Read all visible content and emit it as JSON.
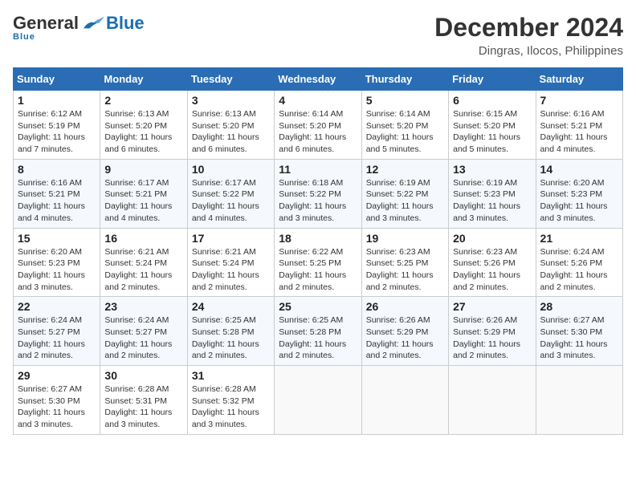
{
  "logo": {
    "general": "General",
    "blue": "Blue",
    "underline": "Blue"
  },
  "title": {
    "month": "December 2024",
    "location": "Dingras, Ilocos, Philippines"
  },
  "weekdays": [
    "Sunday",
    "Monday",
    "Tuesday",
    "Wednesday",
    "Thursday",
    "Friday",
    "Saturday"
  ],
  "weeks": [
    [
      {
        "day": "1",
        "sunrise": "6:12 AM",
        "sunset": "5:19 PM",
        "daylight": "11 hours and 7 minutes."
      },
      {
        "day": "2",
        "sunrise": "6:13 AM",
        "sunset": "5:20 PM",
        "daylight": "11 hours and 6 minutes."
      },
      {
        "day": "3",
        "sunrise": "6:13 AM",
        "sunset": "5:20 PM",
        "daylight": "11 hours and 6 minutes."
      },
      {
        "day": "4",
        "sunrise": "6:14 AM",
        "sunset": "5:20 PM",
        "daylight": "11 hours and 6 minutes."
      },
      {
        "day": "5",
        "sunrise": "6:14 AM",
        "sunset": "5:20 PM",
        "daylight": "11 hours and 5 minutes."
      },
      {
        "day": "6",
        "sunrise": "6:15 AM",
        "sunset": "5:20 PM",
        "daylight": "11 hours and 5 minutes."
      },
      {
        "day": "7",
        "sunrise": "6:16 AM",
        "sunset": "5:21 PM",
        "daylight": "11 hours and 4 minutes."
      }
    ],
    [
      {
        "day": "8",
        "sunrise": "6:16 AM",
        "sunset": "5:21 PM",
        "daylight": "11 hours and 4 minutes."
      },
      {
        "day": "9",
        "sunrise": "6:17 AM",
        "sunset": "5:21 PM",
        "daylight": "11 hours and 4 minutes."
      },
      {
        "day": "10",
        "sunrise": "6:17 AM",
        "sunset": "5:22 PM",
        "daylight": "11 hours and 4 minutes."
      },
      {
        "day": "11",
        "sunrise": "6:18 AM",
        "sunset": "5:22 PM",
        "daylight": "11 hours and 3 minutes."
      },
      {
        "day": "12",
        "sunrise": "6:19 AM",
        "sunset": "5:22 PM",
        "daylight": "11 hours and 3 minutes."
      },
      {
        "day": "13",
        "sunrise": "6:19 AM",
        "sunset": "5:23 PM",
        "daylight": "11 hours and 3 minutes."
      },
      {
        "day": "14",
        "sunrise": "6:20 AM",
        "sunset": "5:23 PM",
        "daylight": "11 hours and 3 minutes."
      }
    ],
    [
      {
        "day": "15",
        "sunrise": "6:20 AM",
        "sunset": "5:23 PM",
        "daylight": "11 hours and 3 minutes."
      },
      {
        "day": "16",
        "sunrise": "6:21 AM",
        "sunset": "5:24 PM",
        "daylight": "11 hours and 2 minutes."
      },
      {
        "day": "17",
        "sunrise": "6:21 AM",
        "sunset": "5:24 PM",
        "daylight": "11 hours and 2 minutes."
      },
      {
        "day": "18",
        "sunrise": "6:22 AM",
        "sunset": "5:25 PM",
        "daylight": "11 hours and 2 minutes."
      },
      {
        "day": "19",
        "sunrise": "6:23 AM",
        "sunset": "5:25 PM",
        "daylight": "11 hours and 2 minutes."
      },
      {
        "day": "20",
        "sunrise": "6:23 AM",
        "sunset": "5:26 PM",
        "daylight": "11 hours and 2 minutes."
      },
      {
        "day": "21",
        "sunrise": "6:24 AM",
        "sunset": "5:26 PM",
        "daylight": "11 hours and 2 minutes."
      }
    ],
    [
      {
        "day": "22",
        "sunrise": "6:24 AM",
        "sunset": "5:27 PM",
        "daylight": "11 hours and 2 minutes."
      },
      {
        "day": "23",
        "sunrise": "6:24 AM",
        "sunset": "5:27 PM",
        "daylight": "11 hours and 2 minutes."
      },
      {
        "day": "24",
        "sunrise": "6:25 AM",
        "sunset": "5:28 PM",
        "daylight": "11 hours and 2 minutes."
      },
      {
        "day": "25",
        "sunrise": "6:25 AM",
        "sunset": "5:28 PM",
        "daylight": "11 hours and 2 minutes."
      },
      {
        "day": "26",
        "sunrise": "6:26 AM",
        "sunset": "5:29 PM",
        "daylight": "11 hours and 2 minutes."
      },
      {
        "day": "27",
        "sunrise": "6:26 AM",
        "sunset": "5:29 PM",
        "daylight": "11 hours and 2 minutes."
      },
      {
        "day": "28",
        "sunrise": "6:27 AM",
        "sunset": "5:30 PM",
        "daylight": "11 hours and 3 minutes."
      }
    ],
    [
      {
        "day": "29",
        "sunrise": "6:27 AM",
        "sunset": "5:30 PM",
        "daylight": "11 hours and 3 minutes."
      },
      {
        "day": "30",
        "sunrise": "6:28 AM",
        "sunset": "5:31 PM",
        "daylight": "11 hours and 3 minutes."
      },
      {
        "day": "31",
        "sunrise": "6:28 AM",
        "sunset": "5:32 PM",
        "daylight": "11 hours and 3 minutes."
      },
      null,
      null,
      null,
      null
    ]
  ]
}
